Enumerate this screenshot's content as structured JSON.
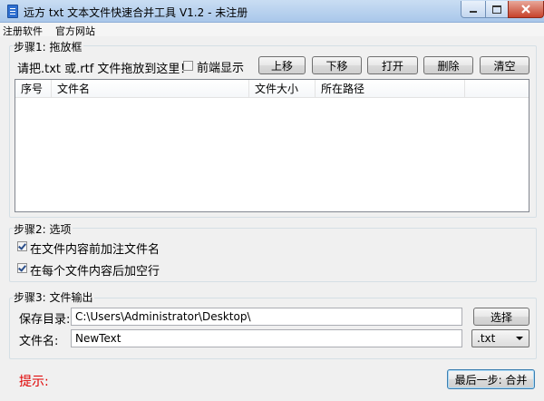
{
  "window": {
    "title": "远方 txt 文本文件快速合并工具 V1.2 - 未注册"
  },
  "menu": {
    "items": [
      "注册软件",
      "官方网站"
    ]
  },
  "step1": {
    "label": "步骤1: 拖放框",
    "hint": "请把.txt 或.rtf 文件拖放到这里！",
    "topmost_label": "前端显示",
    "topmost_checked": false,
    "buttons": {
      "up": "上移",
      "down": "下移",
      "open": "打开",
      "delete": "删除",
      "clear": "清空"
    },
    "columns": [
      "序号",
      "文件名",
      "文件大小",
      "所在路径"
    ]
  },
  "step2": {
    "label": "步骤2: 选项",
    "opt1": {
      "label": "在文件内容前加注文件名",
      "checked": true
    },
    "opt2": {
      "label": "在每个文件内容后加空行",
      "checked": true
    }
  },
  "step3": {
    "label": "步骤3: 文件输出",
    "dir_label": "保存目录:",
    "dir_value": "C:\\Users\\Administrator\\Desktop\\",
    "browse": "选择",
    "name_label": "文件名:",
    "name_value": "NewText",
    "ext_value": ".txt"
  },
  "footer": {
    "tip_label": "提示:",
    "merge_button": "最后一步: 合并"
  },
  "colors": {
    "tip_text": "#e00000",
    "focus_border": "#3c7fb1"
  }
}
